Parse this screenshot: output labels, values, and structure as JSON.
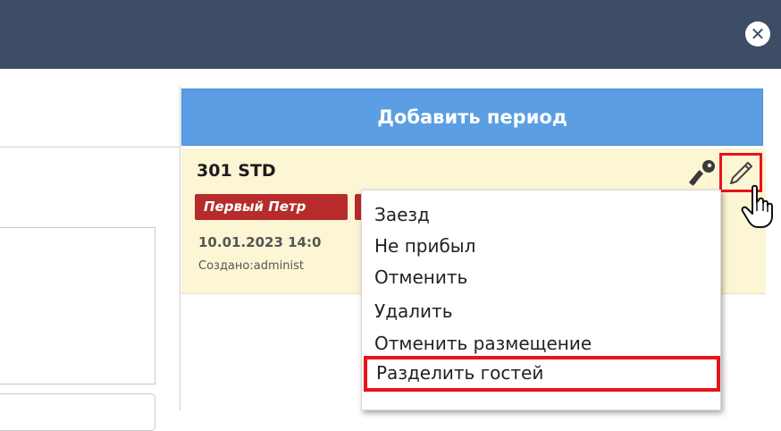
{
  "header": {
    "close_icon": "close-circle-icon"
  },
  "panel": {
    "add_period_label": "Добавить период",
    "booking": {
      "room": "301 STD",
      "guest": "Первый Петр",
      "dates": "10.01.2023 14:0",
      "created": "Создано:administ"
    }
  },
  "context_menu": {
    "items": [
      "Заезд",
      "Не прибыл",
      "Отменить",
      "Удалить",
      "Отменить размещение",
      "Разделить гостей"
    ]
  },
  "colors": {
    "header": "#3d4d66",
    "add_period": "#5b9ee3",
    "booking_bg": "#fcf6d4",
    "guest_badge": "#b82b2b",
    "highlight": "#e8131b"
  }
}
